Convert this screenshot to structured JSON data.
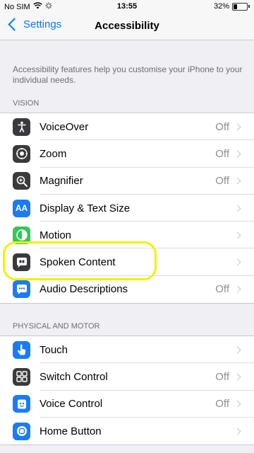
{
  "status_bar": {
    "carrier": "No SIM",
    "time": "13:55",
    "battery": "32%",
    "battery_level": 0.32
  },
  "nav": {
    "back_label": "Settings",
    "title": "Accessibility"
  },
  "description": "Accessibility features help you customise your iPhone to your individual needs.",
  "vision": {
    "header": "VISION",
    "items": [
      {
        "label": "VoiceOver",
        "value": "Off",
        "icon": "voiceover-icon",
        "color": "#3a3a3c"
      },
      {
        "label": "Zoom",
        "value": "Off",
        "icon": "zoom-icon",
        "color": "#3a3a3c"
      },
      {
        "label": "Magnifier",
        "value": "Off",
        "icon": "magnifier-icon",
        "color": "#3a3a3c"
      },
      {
        "label": "Display & Text Size",
        "value": "",
        "icon": "text-size-icon",
        "glyph": "AA",
        "color": "#1a7cf5"
      },
      {
        "label": "Motion",
        "value": "",
        "icon": "motion-icon",
        "color": "#34c759"
      },
      {
        "label": "Spoken Content",
        "value": "",
        "icon": "spoken-content-icon",
        "color": "#3a3a3c"
      },
      {
        "label": "Audio Descriptions",
        "value": "Off",
        "icon": "audio-descriptions-icon",
        "color": "#1a7cf5"
      }
    ]
  },
  "physical_motor": {
    "header": "PHYSICAL AND MOTOR",
    "items": [
      {
        "label": "Touch",
        "value": "",
        "icon": "touch-icon",
        "color": "#1a7cf5"
      },
      {
        "label": "Switch Control",
        "value": "Off",
        "icon": "switch-control-icon",
        "color": "#3a3a3c"
      },
      {
        "label": "Voice Control",
        "value": "Off",
        "icon": "voice-control-icon",
        "color": "#1a7cf5"
      },
      {
        "label": "Home Button",
        "value": "",
        "icon": "home-button-icon",
        "color": "#1a7cf5"
      }
    ]
  },
  "highlight_color": "#f5f000"
}
